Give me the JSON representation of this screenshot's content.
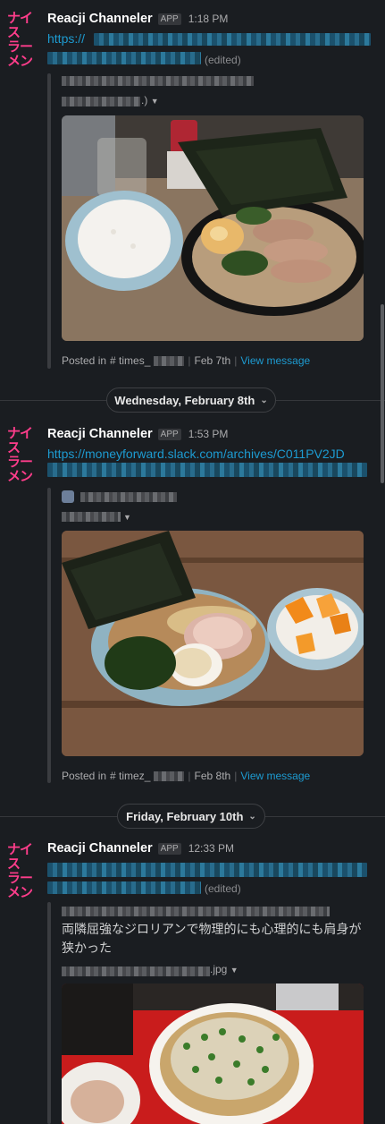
{
  "messages": [
    {
      "avatar_lines": [
        "ナイス",
        "ラーメン"
      ],
      "sender": "Reacji Channeler",
      "badge": "APP",
      "time": "1:18 PM",
      "link_prefix": "https://",
      "edited": "(edited)",
      "caption_tail": ".)",
      "posted_in": "Posted in",
      "channel": "# times_",
      "date": "Feb 7th",
      "view": "View message"
    },
    {
      "avatar_lines": [
        "ナイス",
        "ラーメン"
      ],
      "sender": "Reacji Channeler",
      "badge": "APP",
      "time": "1:53 PM",
      "link_prefix": "https://moneyforward.slack.com/archives/C011PV2JD",
      "caption_tail": "",
      "posted_in": "Posted in",
      "channel": "# timez_",
      "date": "Feb 8th",
      "view": "View message"
    },
    {
      "avatar_lines": [
        "ナイス",
        "ラーメン"
      ],
      "sender": "Reacji Channeler",
      "badge": "APP",
      "time": "12:33 PM",
      "edited": "(edited)",
      "quote_text": "両隣屈強なジロリアンで物理的にも心理的にも肩身が狭かった",
      "file_ext": ".jpg"
    }
  ],
  "day_dividers": [
    {
      "label": "Wednesday, February 8th"
    },
    {
      "label": "Friday, February 10th"
    }
  ],
  "icons": {
    "dropdown": "chevron-down-icon",
    "collapse": "caret-down-icon"
  }
}
